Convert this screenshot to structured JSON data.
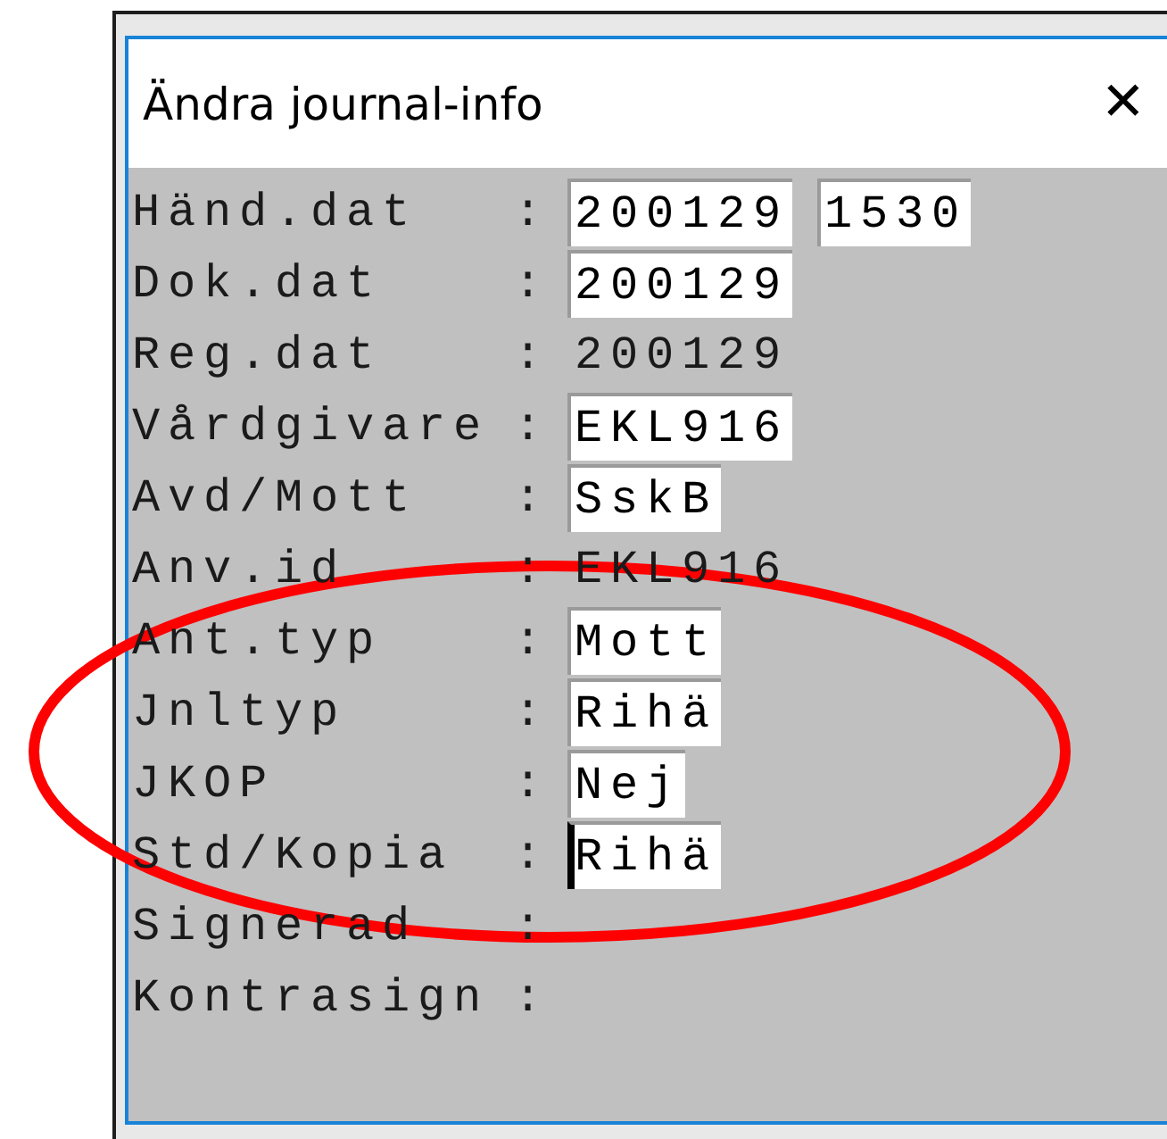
{
  "window": {
    "title": "Ändra journal-info",
    "close": "✕"
  },
  "rows": [
    {
      "label": "Händ.dat",
      "separator": ":",
      "values": [
        {
          "kind": "field",
          "text": "200129",
          "focused": false
        },
        {
          "kind": "field",
          "text": "1530",
          "focused": false
        }
      ]
    },
    {
      "label": "Dok.dat",
      "separator": ":",
      "values": [
        {
          "kind": "field",
          "text": "200129",
          "focused": false
        }
      ]
    },
    {
      "label": "Reg.dat",
      "separator": ":",
      "values": [
        {
          "kind": "text",
          "text": "200129"
        }
      ]
    },
    {
      "label": "Vårdgivare",
      "separator": ":",
      "values": [
        {
          "kind": "field",
          "text": "EKL916",
          "focused": false
        }
      ]
    },
    {
      "label": "Avd/Mott",
      "separator": ":",
      "values": [
        {
          "kind": "field",
          "text": "SskB",
          "focused": false
        }
      ]
    },
    {
      "label": "Anv.id",
      "separator": ":",
      "values": [
        {
          "kind": "text",
          "text": "EKL916"
        }
      ]
    },
    {
      "label": "Ant.typ",
      "separator": ":",
      "values": [
        {
          "kind": "field",
          "text": "Mott",
          "focused": false
        }
      ]
    },
    {
      "label": "Jnltyp",
      "separator": ":",
      "values": [
        {
          "kind": "field",
          "text": "Rihä",
          "focused": false
        }
      ]
    },
    {
      "label": "JKOP",
      "separator": ":",
      "values": [
        {
          "kind": "field",
          "text": "Nej",
          "focused": false
        }
      ]
    },
    {
      "label": "Std/Kopia",
      "separator": ":",
      "values": [
        {
          "kind": "field",
          "text": "Rihä",
          "focused": true
        }
      ]
    },
    {
      "label": "Signerad",
      "separator": ":",
      "values": []
    },
    {
      "label": "Kontrasign",
      "separator": ":",
      "values": []
    }
  ],
  "annotation": {
    "kind": "ellipse",
    "color": "#ff0000"
  }
}
